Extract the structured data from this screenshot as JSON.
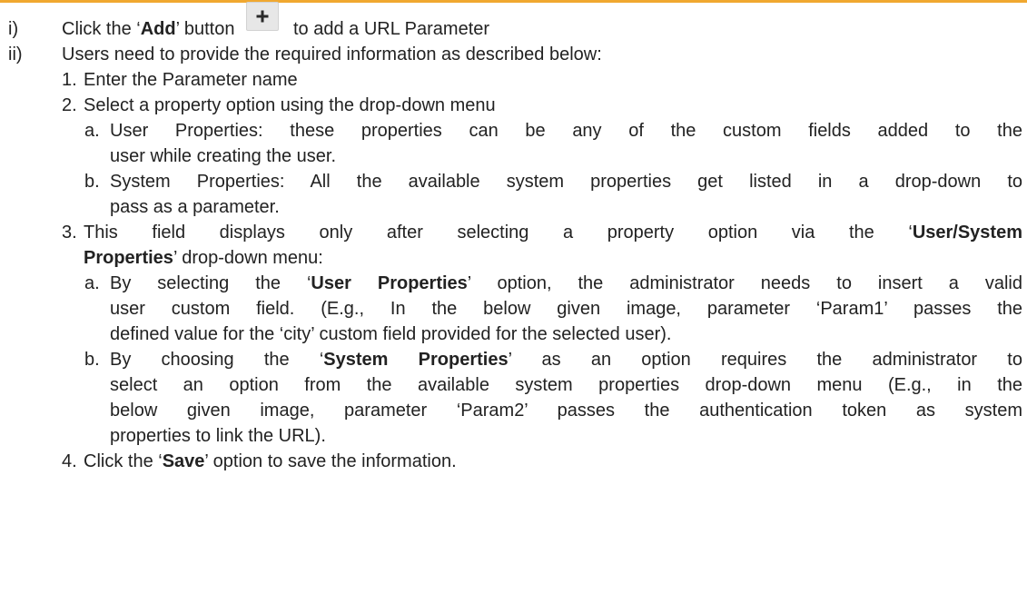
{
  "steps": [
    {
      "marker": "i)",
      "pre": "Click the ‘",
      "bold": "Add",
      "post": "’ button",
      "after": "to add a URL Parameter",
      "button_icon": "plus-icon"
    },
    {
      "marker": "ii)",
      "text": "Users need to provide the required information as described below:",
      "items": [
        {
          "marker": "1.",
          "text": "Enter the Parameter name"
        },
        {
          "marker": "2.",
          "text": "Select a property option using the drop-down menu",
          "sub": [
            {
              "marker": "a.",
              "line1": "User Properties: these properties can be any of the custom fields added to the",
              "line2": "user while creating the user."
            },
            {
              "marker": "b.",
              "line1": "System Properties: All the available system properties get listed in a drop-down to",
              "line2": "pass as a parameter."
            }
          ]
        },
        {
          "marker": "3.",
          "line1_pre": "This field displays only after selecting a property option via the ‘",
          "line1_bold": "User/System",
          "line2_bold": "Properties",
          "line2_post": "’ drop-down menu:",
          "sub": [
            {
              "marker": "a.",
              "line1_pre": "By selecting the ‘",
              "line1_bold": "User Properties",
              "line1_post": "’ option, the administrator needs to insert a valid",
              "line2": "user custom field. (E.g., In the below given image, parameter ‘Param1’ passes the",
              "line3": "defined value for the ‘city’ custom field provided for the selected user)."
            },
            {
              "marker": "b.",
              "line1_pre": "By choosing the ‘",
              "line1_bold": "System Properties",
              "line1_post": "’ as an option requires the administrator to",
              "line2": "select an option from the available system properties drop-down menu (E.g., in the",
              "line3": "below given image, parameter ‘Param2’ passes the authentication token as system",
              "line4": "properties to link the URL)."
            }
          ]
        },
        {
          "marker": "4.",
          "pre": "Click the ‘",
          "bold": "Save",
          "post": "’ option to save the information."
        }
      ]
    }
  ],
  "colors": {
    "accent_rule": "#f0a830",
    "text": "#222222",
    "button_bg": "#e7e7e7"
  }
}
